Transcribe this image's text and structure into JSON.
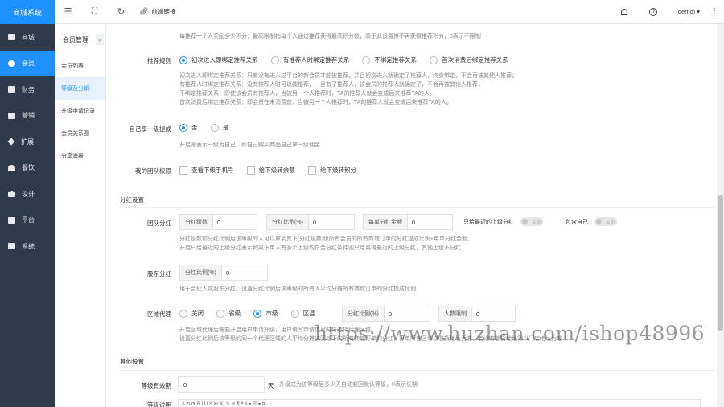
{
  "sidebar": {
    "brand": "商城系统",
    "items": [
      {
        "label": "商城",
        "icon": "shop-icon"
      },
      {
        "label": "会员",
        "icon": "member-icon",
        "active": true
      },
      {
        "label": "财务",
        "icon": "finance-icon"
      },
      {
        "label": "营销",
        "icon": "marketing-icon"
      },
      {
        "label": "扩展",
        "icon": "extension-icon"
      },
      {
        "label": "餐饮",
        "icon": "catering-icon"
      },
      {
        "label": "设计",
        "icon": "design-icon"
      },
      {
        "label": "平台",
        "icon": "platform-icon"
      },
      {
        "label": "系统",
        "icon": "system-icon"
      }
    ]
  },
  "subnav": {
    "title": "会员管理",
    "collapse": "«",
    "items": [
      "会员列表",
      "等级及分销",
      "升级申请记录",
      "会员关系图",
      "分享海报"
    ],
    "active_index": 1
  },
  "topbar": {
    "front_link": "前端链接",
    "user": "(demo) ▾"
  },
  "form": {
    "top_help": "每推荐一个人奖励多少积分；最高限制指每个人通过推荐获得最高积分数，高于此设置将不再获得推荐积分，0表示不限制",
    "recommend_rule": {
      "label": "推荐规则",
      "options": [
        "初次进入即绑定推荐关系",
        "有推荐人时绑定推荐关系",
        "不绑定推荐关系",
        "首次消费后绑定推荐关系"
      ],
      "selected": 0,
      "help": [
        "初次进入即绑定推荐关系：只有没有进入过平台的新会员才能被推荐，并且初次进入就确定了推荐人，终身绑定，不会再被其他人推荐；",
        "有推荐人时绑定推荐关系：没有推荐人时可以被推荐，一旦有了推荐人，该会员的推荐人就确定了，不会再被其他人推荐；",
        "不绑定推荐关系：即使该会员有推荐人，当被另一个人推荐时，TA的推荐人就会变成后来推荐TA的人。",
        "首次消费后绑定推荐关系：即会员在未消费前，当被另一个人推荐时，TA的推荐人就会变成后来推荐TA的人。"
      ]
    },
    "self_first": {
      "label": "自己享一级提成",
      "options": [
        "否",
        "是"
      ],
      "selected": 0,
      "help": "开启则表示一级为自己，即自己购买商品自己拿一级佣金"
    },
    "team_perm": {
      "label": "我的团队权限",
      "options": [
        "查看下级手机号",
        "给下级转余额",
        "给下级转积分"
      ]
    },
    "dividend_section": "分红设置",
    "team_dividend": {
      "label": "团队分红",
      "fields": [
        {
          "label": "分红级数",
          "value": "0"
        },
        {
          "label": "分红比例(%)",
          "value": "0"
        },
        {
          "label": "每单分红金额",
          "value": "0"
        }
      ],
      "toggle1_label": "只给最近的上级分红",
      "toggle2_label": "包含自己",
      "toggle_text": "关闭",
      "help": [
        "分红级数和分红比例后该等级的人可以拿到其下[分红级数]级所有会员的所有商城订单的分红提成比例+每单分红金额;",
        "开启只给最近的上级分红表示如果下单人有多个上级均符合分红条件则只给离得最近的上级分红，其他上级不分红"
      ]
    },
    "shareholder": {
      "label": "股东分红",
      "field_label": "分红比例(%)",
      "value": "0",
      "help": "用于合伙人或股东分红，设置分红比例后该等级的所有人平均分摊所有商城订单的分红提成比例"
    },
    "region": {
      "label": "区域代理",
      "options": [
        "关闭",
        "省级",
        "市级",
        "区县"
      ],
      "selected": 2,
      "ratio_label": "分红比例(%)",
      "ratio_value": "0",
      "limit_label": "人数限制",
      "limit_value": "0",
      "help": [
        "开启区域代理后需要开启用户申请升级，用户填写申请信息时将选择代理区域",
        "设置分红比例后该等级的同一个代理区域的人平均分摊该区域下的所有商城订单的分红，订单所在区域以收货地址为准，若没有收货地址则以门店地址为准"
      ]
    },
    "other_section": "其他设置",
    "validity": {
      "label": "等级有效期",
      "value": "0",
      "unit": "天",
      "help": "升级成为该等级后多少天自动变回默认等级，0表示长期"
    },
    "desc_label": "等级说明",
    "editor_tools": "A ⟲ ⟳ B I U S X² X₂ ✎ ✐ ¶ ❝ A ▾ ☰ ▾ ⊞"
  },
  "watermark": "https://www.huzhan.com/ishop48996"
}
